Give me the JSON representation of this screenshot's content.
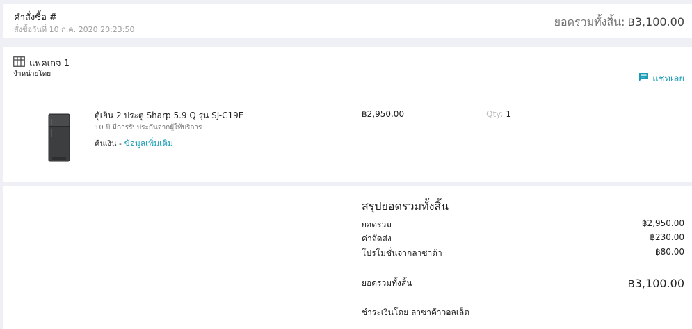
{
  "order": {
    "title": "คำสั่งซื้อ #",
    "date": "สั่งซื้อวันที่ 10 ก.ค. 2020 20:23:50",
    "total_label": "ยอดรวมทั้งสิ้น:",
    "total_value": "฿3,100.00"
  },
  "package": {
    "title": "แพคเกจ 1",
    "sold_by": "จำหน่ายโดย",
    "chat_label": "แชทเลย",
    "item": {
      "name": "ตู้เย็น 2 ประตู Sharp 5.9 Q รุ่น SJ-C19E",
      "warranty": "10 ปี มีการรับประกันจากผู้ให้บริการ",
      "return_label": "คืนเงิน -",
      "more_info": "ข้อมูลเพิ่มเติม",
      "price": "฿2,950.00",
      "qty_label": "Qty:",
      "qty_value": "1"
    }
  },
  "summary": {
    "title": "สรุปยอดรวมทั้งสิ้น",
    "rows": [
      {
        "label": "ยอดรวม",
        "value": "฿2,950.00"
      },
      {
        "label": "ค่าจัดส่ง",
        "value": "฿230.00"
      },
      {
        "label": "โปรโมชั่นจากลาซาด้า",
        "value": "-฿80.00"
      }
    ],
    "total_label": "ยอดรวมทั้งสิ้น",
    "total_value": "฿3,100.00",
    "payment": "ชำระเงินโดย ลาซาด้าวอลเล็ต"
  },
  "colors": {
    "accent": "#1a9cb7",
    "background": "#eff0f5"
  }
}
